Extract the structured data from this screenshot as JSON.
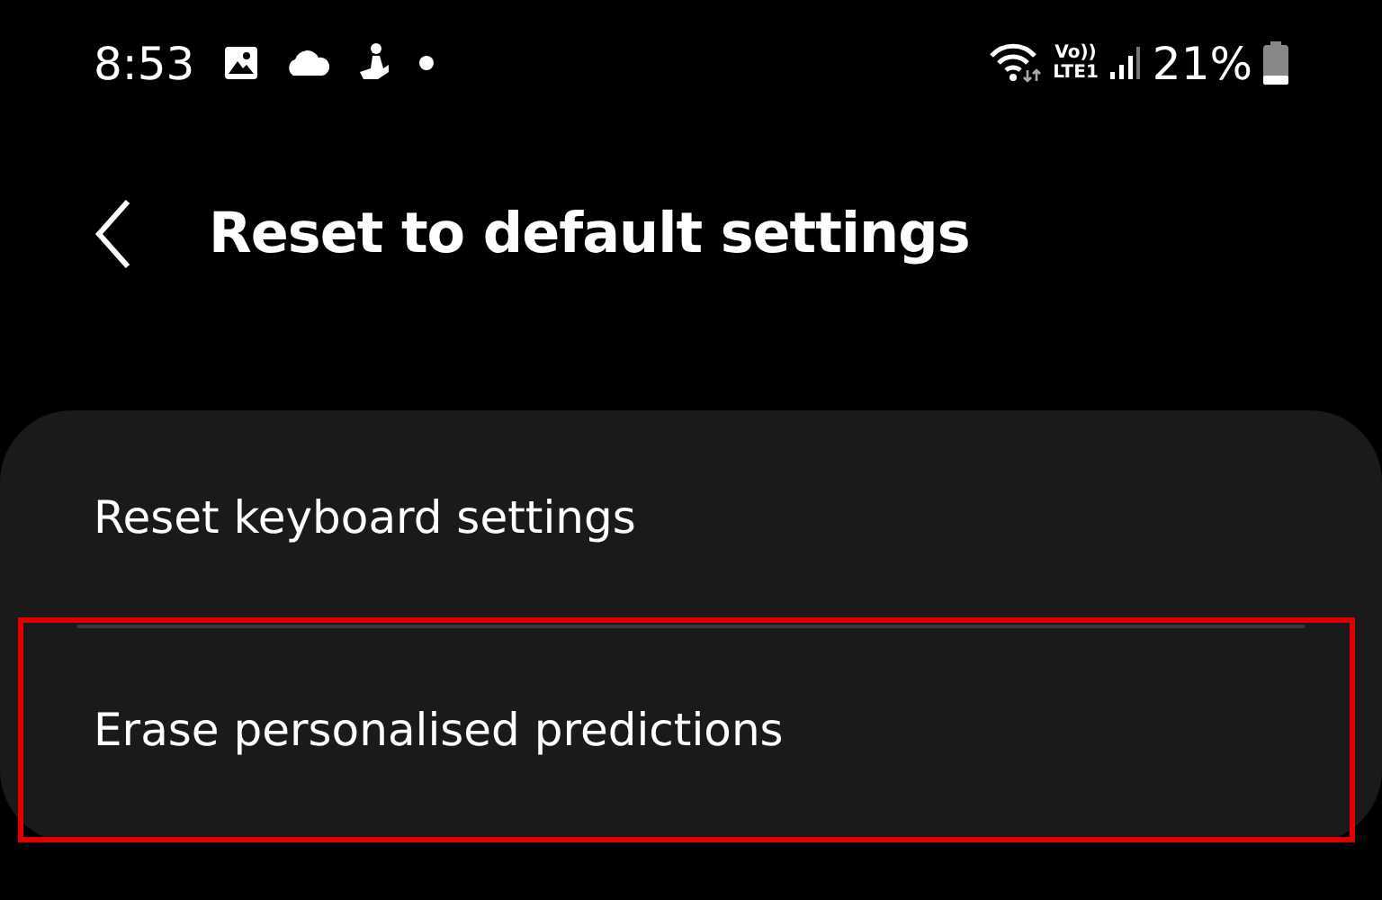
{
  "status_bar": {
    "time": "8:53",
    "volte_label": "Vo))",
    "network_label": "LTE1",
    "battery": "21%"
  },
  "header": {
    "title": "Reset to default settings"
  },
  "items": [
    {
      "label": "Reset keyboard settings",
      "highlighted": false
    },
    {
      "label": "Erase personalised predictions",
      "highlighted": true
    }
  ]
}
